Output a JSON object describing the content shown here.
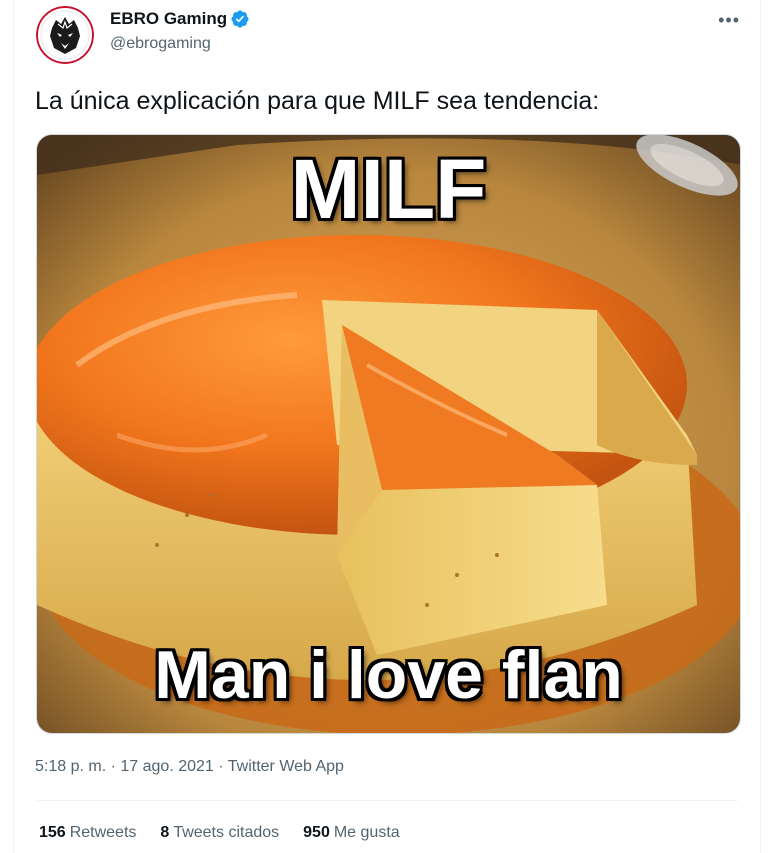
{
  "author": {
    "display_name": "EBRO Gaming",
    "handle": "@ebrogaming",
    "verified": true,
    "avatar_icon": "lion-logo-icon"
  },
  "tweet": {
    "text": "La única explicación para que MILF sea tendencia:",
    "media": {
      "top_caption": "MILF",
      "bottom_caption": "Man i love flan"
    }
  },
  "meta": {
    "time": "5:18 p. m.",
    "separator": "·",
    "date": "17 ago. 2021",
    "source": "Twitter Web App"
  },
  "stats": {
    "retweets_count": "156",
    "retweets_label": "Retweets",
    "quotes_count": "8",
    "quotes_label": "Tweets citados",
    "likes_count": "950",
    "likes_label": "Me gusta"
  },
  "colors": {
    "verified_blue": "#1d9bf0",
    "secondary_text": "#536471",
    "primary_text": "#0f1419"
  }
}
